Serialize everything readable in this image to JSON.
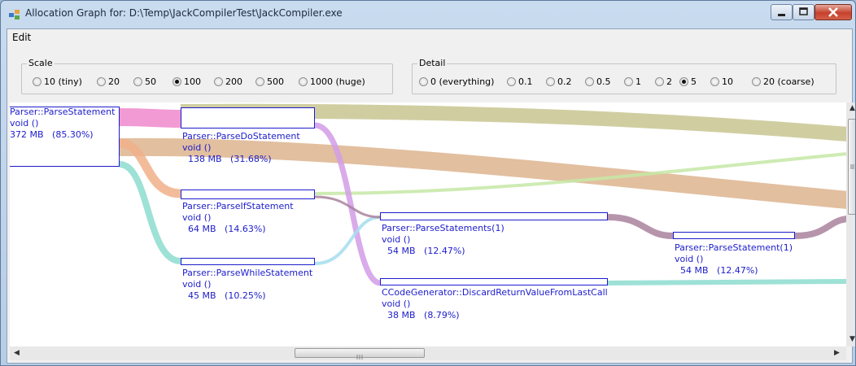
{
  "window": {
    "title": "Allocation Graph for: D:\\Temp\\JackCompilerTest\\JackCompiler.exe"
  },
  "menu": {
    "items": [
      "Edit"
    ]
  },
  "scale": {
    "label": "Scale",
    "options": [
      "10 (tiny)",
      "20",
      "50",
      "100",
      "200",
      "500",
      "1000 (huge)"
    ],
    "selected": "100"
  },
  "detail": {
    "label": "Detail",
    "options": [
      "0 (everything)",
      "0.1",
      "0.2",
      "0.5",
      "1",
      "2",
      "5",
      "10",
      "20 (coarse)"
    ],
    "selected": "5"
  },
  "nodes": [
    {
      "name": "Parser::ParseStatement",
      "sig": "void ()",
      "size": "372 MB",
      "pct": "(85.30%)"
    },
    {
      "name": "Parser::ParseDoStatement",
      "sig": "void ()",
      "size": "138 MB",
      "pct": "(31.68%)"
    },
    {
      "name": "Parser::ParseIfStatement",
      "sig": "void ()",
      "size": "64 MB",
      "pct": "(14.63%)"
    },
    {
      "name": "Parser::ParseWhileStatement",
      "sig": "void ()",
      "size": "45 MB",
      "pct": "(10.25%)"
    },
    {
      "name": "Parser::ParseStatements(1)",
      "sig": "void ()",
      "size": "54 MB",
      "pct": "(12.47%)"
    },
    {
      "name": "CCodeGenerator::DiscardReturnValueFromLastCall",
      "sig": "void ()",
      "size": "38 MB",
      "pct": "(8.79%)"
    },
    {
      "name": "Parser::ParseStatement(1)",
      "sig": "void ()",
      "size": "54 MB",
      "pct": "(12.47%)"
    }
  ],
  "colors": {
    "pink": "#ee88cc",
    "olive": "#c8c690",
    "tan": "#ddb48e",
    "orange": "#f0b08a",
    "teal": "#8ddccf",
    "lightgreen": "#c6e8a6",
    "violet": "#d29ce6",
    "mauve": "#a9829e",
    "lightblue": "#a6ddee",
    "node_blue": "#1c1ccc"
  }
}
